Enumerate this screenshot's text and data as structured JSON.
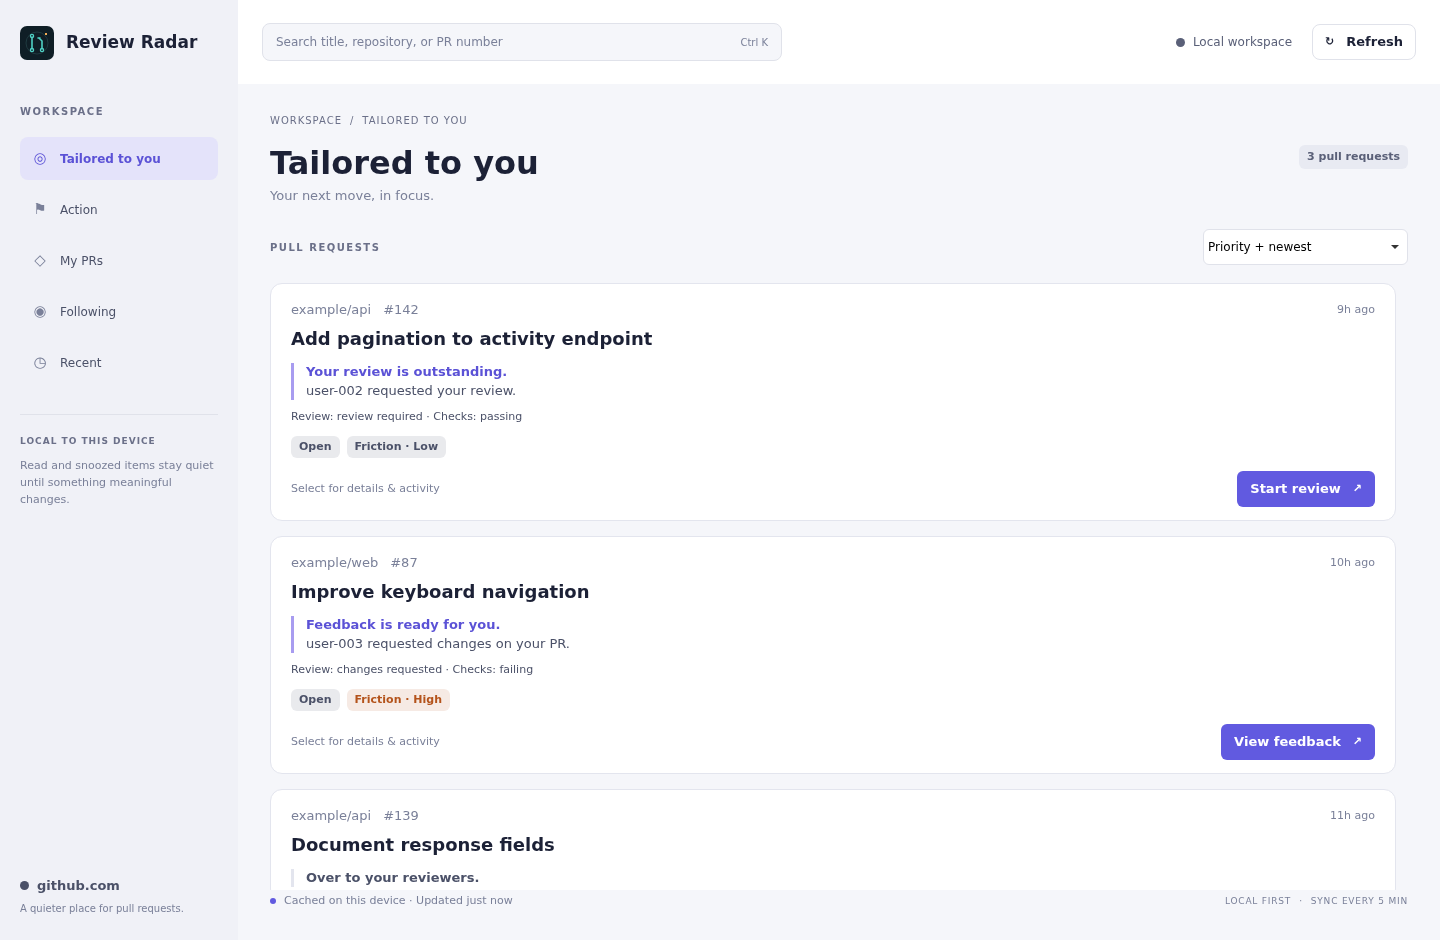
{
  "app": {
    "name": "Review Radar"
  },
  "sidebar": {
    "section_title": "WORKSPACE",
    "items": [
      {
        "icon": "◎",
        "label": "Tailored to you",
        "selected": true
      },
      {
        "icon": "⚑",
        "label": "Action",
        "selected": false
      },
      {
        "icon": "◇",
        "label": "My PRs",
        "selected": false
      },
      {
        "icon": "◉",
        "label": "Following",
        "selected": false
      },
      {
        "icon": "◷",
        "label": "Recent",
        "selected": false
      }
    ],
    "note": {
      "title": "LOCAL TO THIS DEVICE",
      "text": "Read and snoozed items stay quiet until something meaningful changes."
    },
    "footer": {
      "host": "github.com",
      "tagline": "A quieter place for pull requests."
    }
  },
  "header": {
    "search": {
      "placeholder": "Search title, repository, or PR number",
      "shortcut": "Ctrl K"
    },
    "workspace": "Local workspace",
    "refresh": {
      "icon": "↻",
      "label": "Refresh"
    }
  },
  "breadcrumb": {
    "items": [
      "WORKSPACE",
      "TAILORED TO YOU"
    ],
    "separator": "/"
  },
  "page": {
    "title": "Tailored to you",
    "subtitle": "Your next move, in focus.",
    "count": "3 pull requests"
  },
  "list": {
    "title": "PULL REQUESTS",
    "sort": "Priority + newest",
    "cards": [
      {
        "repo": "example/api",
        "number": "#142",
        "time": "9h ago",
        "title": "Add pagination to activity endpoint",
        "callout": {
          "emphasized": true,
          "title": "Your review is outstanding.",
          "text": "user-002 requested your review."
        },
        "meta": "Review: review required · Checks: passing",
        "tags": [
          {
            "label": "Open",
            "color": "#4b5168"
          },
          {
            "label": "Friction · Low",
            "color": "#4b5168"
          }
        ],
        "hint": "Select for details & activity",
        "action": {
          "label": "Start review",
          "icon": "↗"
        }
      },
      {
        "repo": "example/web",
        "number": "#87",
        "time": "10h ago",
        "title": "Improve keyboard navigation",
        "callout": {
          "emphasized": true,
          "title": "Feedback is ready for you.",
          "text": "user-003 requested changes on your PR."
        },
        "meta": "Review: changes requested · Checks: failing",
        "tags": [
          {
            "label": "Open",
            "color": "#4b5168"
          },
          {
            "label": "Friction · High",
            "color": "#b4531b"
          }
        ],
        "hint": "Select for details & activity",
        "action": {
          "label": "View feedback",
          "icon": "↗"
        }
      },
      {
        "repo": "example/api",
        "number": "#139",
        "time": "11h ago",
        "title": "Document response fields",
        "callout": {
          "emphasized": false,
          "title": "Over to your reviewers."
        }
      }
    ]
  },
  "status_bar": {
    "text": "Cached on this device · Updated just now",
    "right": [
      "LOCAL FIRST",
      "·",
      "SYNC EVERY 5 MIN"
    ]
  }
}
